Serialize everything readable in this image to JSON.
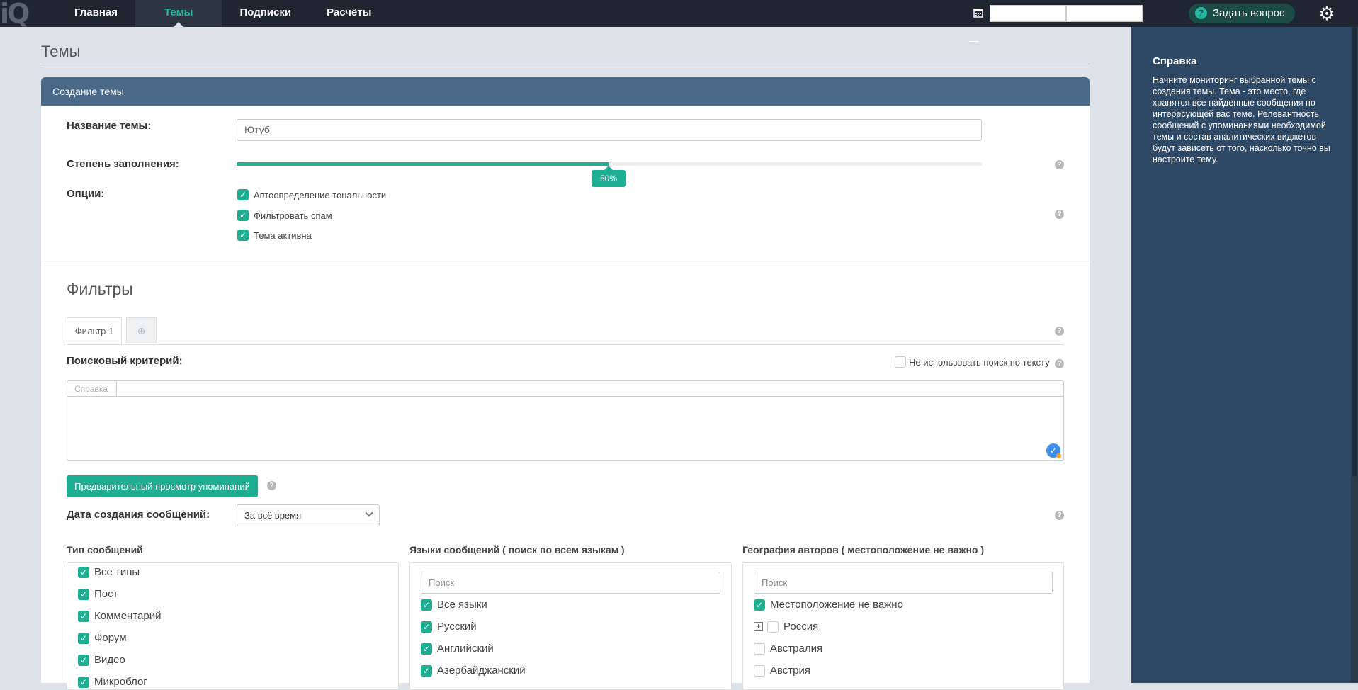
{
  "nav": {
    "logo": "iQ",
    "items": [
      "Главная",
      "Темы",
      "Подписки",
      "Расчёты"
    ]
  },
  "header": {
    "ask_label": "Задать вопрос"
  },
  "page": {
    "title": "Темы"
  },
  "card": {
    "title": "Создание темы",
    "name_label": "Название темы:",
    "name_value": "Ютуб",
    "fill_label": "Степень заполнения:",
    "fill_value": "50%",
    "fill_fraction": 0.5,
    "options_label": "Опции:",
    "options": [
      "Автоопределение тональности",
      "Фильтровать спам",
      "Тема активна"
    ]
  },
  "filters": {
    "title": "Фильтры",
    "tab_label": "Фильтр 1",
    "criteria_label": "Поисковый критерий:",
    "no_text_search": "Не использовать поиск по тексту",
    "editor_help": "Справка",
    "preview_label": "Предварительный просмотр упоминаний",
    "date_label": "Дата создания сообщений:",
    "date_value": "За всё время"
  },
  "types": {
    "title": "Тип сообщений",
    "items": [
      "Все типы",
      "Пост",
      "Комментарий",
      "Форум",
      "Видео",
      "Микроблог"
    ]
  },
  "languages": {
    "title": "Языки сообщений ( поиск по всем языкам )",
    "search_placeholder": "Поиск",
    "items": [
      "Все языки",
      "Русский",
      "Английский",
      "Азербайджанский"
    ]
  },
  "geo": {
    "title": "География авторов ( местоположение не важно )",
    "search_placeholder": "Поиск",
    "items": [
      "Местоположение не важно",
      "Россия",
      "Австралия",
      "Австрия"
    ]
  },
  "help": {
    "title": "Справка",
    "text": "Начните мониторинг выбранной темы с создания темы. Тема - это место, где хранятся все найденные сообщения по интересующей вас теме. Релевантность сообщений с упоминаниями необходимой темы и состав аналитических виджетов будут зависеть от того, насколько точно вы настроите тему."
  }
}
